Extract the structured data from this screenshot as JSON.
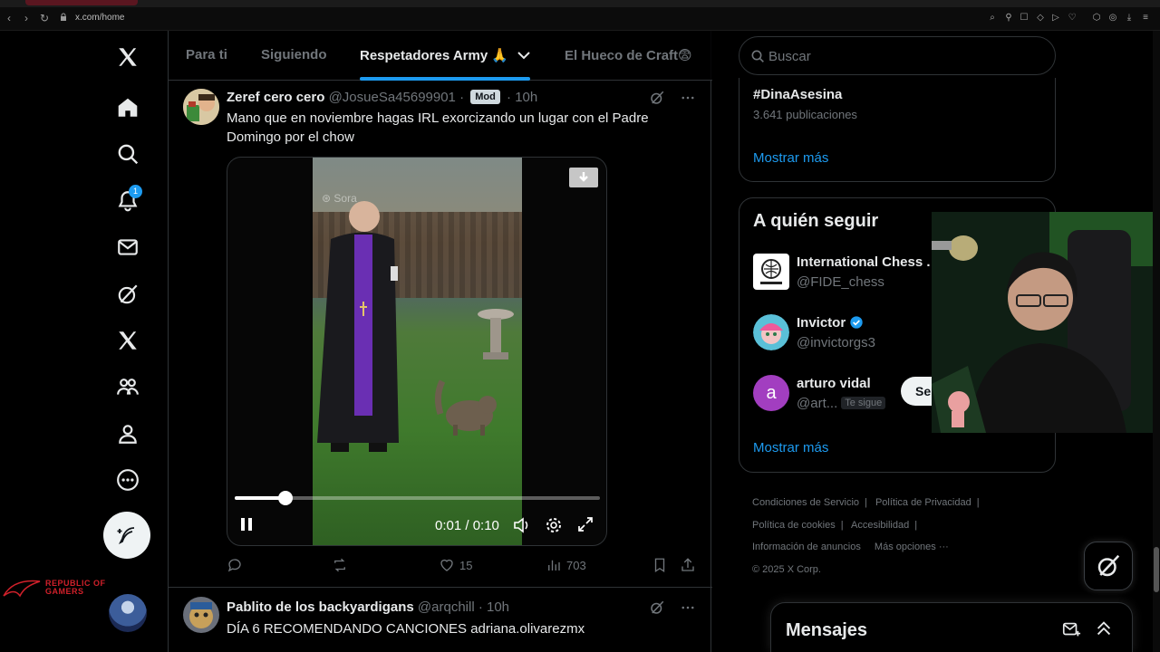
{
  "browser": {
    "url": "x.com/home"
  },
  "nav": {
    "notification_count": "1"
  },
  "tabs": [
    "Para ti",
    "Siguiendo",
    "Respetadores Army 🙏",
    "El Hueco de Craft😨"
  ],
  "tweet1": {
    "name": "Zeref cero cero",
    "handle": "@JosueSa45699901",
    "badge": "Mod",
    "time": "· 10h",
    "text": "Mano que en noviembre hagas IRL exorcizando un lugar con el Padre Domingo por el chow",
    "video": {
      "watermark": "Sora",
      "time": "0:01 / 0:10",
      "progress": 0.14
    },
    "likes": "15",
    "views": "703"
  },
  "tweet2": {
    "name": "Pablito de los backyardigans",
    "handle": "@arqchill",
    "time": "· 10h",
    "text": "DÍA 6 RECOMENDANDO CANCIONES adriana.olivarezmx"
  },
  "sidebar": {
    "search_placeholder": "Buscar",
    "trend": {
      "tag": "#DinaAsesina",
      "count": "3.641 publicaciones",
      "show_more": "Mostrar más"
    },
    "who_to_follow": {
      "title": "A quién seguir",
      "users": [
        {
          "name": "International Chess .",
          "handle": "@FIDE_chess"
        },
        {
          "name": "Invictor",
          "handle": "@invictorgs3"
        },
        {
          "name": "arturo vidal",
          "handle": "@art...",
          "follows_you": "Te sigue",
          "initial": "a",
          "button": "Se"
        }
      ],
      "show_more": "Mostrar más"
    },
    "footer": {
      "links": [
        "Condiciones de Servicio",
        "Política de Privacidad",
        "Política de cookies",
        "Accesibilidad",
        "Información de anuncios",
        "Más opciones ···"
      ],
      "copyright": "© 2025 X Corp."
    }
  },
  "messages": {
    "title": "Mensajes"
  },
  "rog": {
    "line1": "REPUBLIC OF",
    "line2": "GAMERS"
  },
  "colors": {
    "accent": "#1d9bf0",
    "background": "#000000",
    "border": "#2f3336",
    "muted": "#71767b"
  }
}
